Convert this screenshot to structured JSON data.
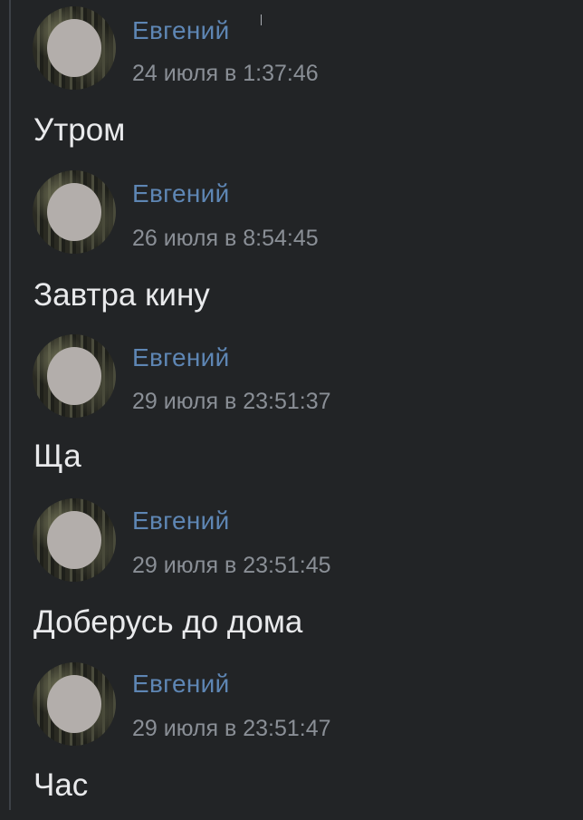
{
  "messages": [
    {
      "author": "Евгений",
      "time": "24 июля в 1:37:46",
      "text": "Утром"
    },
    {
      "author": "Евгений",
      "time": "26 июля в 8:54:45",
      "text": "Завтра кину"
    },
    {
      "author": "Евгений",
      "time": "29 июля в 23:51:37",
      "text": "Ща"
    },
    {
      "author": "Евгений",
      "time": "29 июля в 23:51:45",
      "text": "Доберусь до дома"
    },
    {
      "author": "Евгений",
      "time": "29 июля в 23:51:47",
      "text": "Час"
    }
  ],
  "colors": {
    "background": "#222426",
    "author": "#5e86b4",
    "timestamp": "#8a8f96",
    "text": "#e9eaec"
  }
}
